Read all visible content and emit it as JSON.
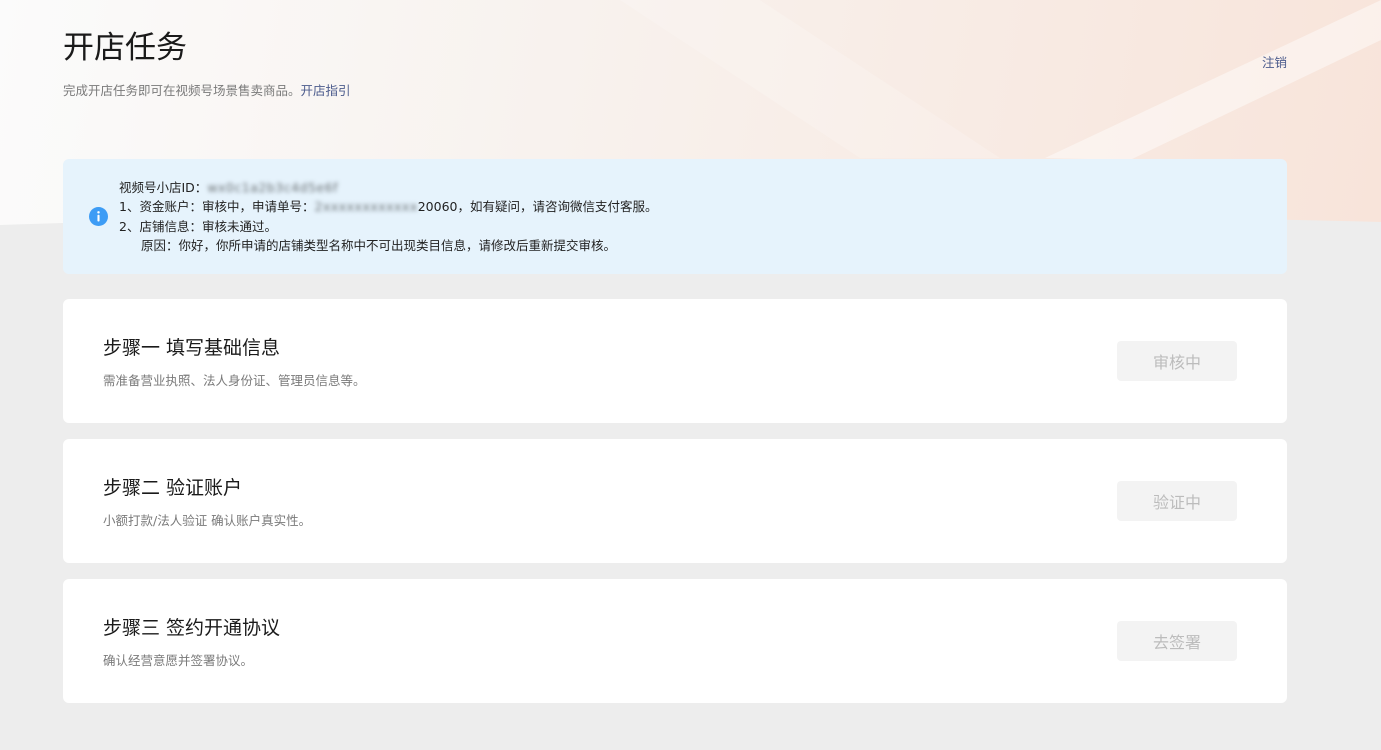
{
  "header": {
    "title": "开店任务",
    "subtitle": "完成开店任务即可在视频号场景售卖商品。",
    "guide_link": "开店指引",
    "logout": "注销"
  },
  "notice": {
    "icon": "info-icon",
    "icon_color": "#3d9cf5",
    "shop_id_label": "视频号小店ID：",
    "shop_id_value": "wx0c1a2b3c4d5e6f",
    "line1_prefix": "1、资金账户：",
    "line1_status": "审核中",
    "line1_mid": "，申请单号：",
    "line1_order_masked": "2xxxxxxxxxxxx",
    "line1_order_tail": "20060",
    "line1_suffix": "，如有疑问，请咨询微信支付客服。",
    "line2_prefix": "2、店铺信息：",
    "line2_status": "审核未通过。",
    "reason": "原因：你好，你所申请的店铺类型名称中不可出现类目信息，请修改后重新提交审核。"
  },
  "steps": [
    {
      "title": "步骤一 填写基础信息",
      "desc": "需准备营业执照、法人身份证、管理员信息等。",
      "button": "审核中"
    },
    {
      "title": "步骤二 验证账户",
      "desc": "小额打款/法人验证 确认账户真实性。",
      "button": "验证中"
    },
    {
      "title": "步骤三 签约开通协议",
      "desc": "确认经营意愿并签署协议。",
      "button": "去签署"
    }
  ]
}
